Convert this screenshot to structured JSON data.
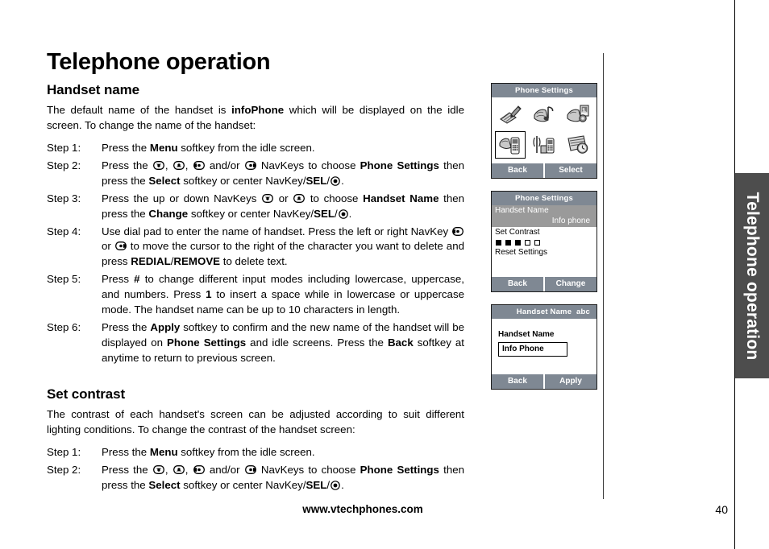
{
  "page": {
    "chapter_title": "Telephone operation",
    "side_tab_label": "Telephone operation",
    "page_number": "40",
    "footer_url": "www.vtechphones.com"
  },
  "sections": {
    "handset_name": {
      "heading": "Handset name",
      "intro_1": "The default name of the handset is ",
      "intro_bold": "infoPhone",
      "intro_2": " which will be displayed on the idle screen. To change the name of the handset:",
      "steps": [
        {
          "label": "Step 1:",
          "text": "Press the Menu softkey from the idle screen."
        },
        {
          "label": "Step 2:",
          "text": "Press the NavKeys to choose Phone Settings then press the Select softkey or center NavKey/SEL."
        },
        {
          "label": "Step 3:",
          "text": "Press the up or down NavKeys to choose Handset Name then press the Change softkey or center NavKey/SEL."
        },
        {
          "label": "Step 4:",
          "text": "Use dial pad to enter the name of handset. Press the left or right NavKey to move the cursor to the right of the character you want to delete and press REDIAL/REMOVE to delete text."
        },
        {
          "label": "Step 5:",
          "text": "Press # to change different input modes including lowercase, uppercase, and numbers. Press 1 to insert a space while in lowercase or uppercase mode. The handset name can be up to 10 characters in length."
        },
        {
          "label": "Step 6:",
          "text": "Press the Apply softkey to confirm and the new name of the handset will be displayed on Phone Settings and idle screens. Press the Back softkey at anytime to return to previous screen."
        }
      ]
    },
    "set_contrast": {
      "heading": "Set contrast",
      "intro": "The contrast of each handset's screen can be adjusted according to suit different lighting conditions. To change the contrast of the handset screen:",
      "steps": [
        {
          "label": "Step 1:",
          "text": "Press the Menu softkey from the idle screen."
        },
        {
          "label": "Step 2:",
          "text": "Press the NavKeys to choose Phone Settings then press the Select softkey or center NavKey/SEL."
        }
      ]
    }
  },
  "inline_terms": {
    "menu": "Menu",
    "select": "Select",
    "change": "Change",
    "apply": "Apply",
    "back": "Back",
    "sel": "SEL",
    "redial": "REDIAL",
    "remove": "REMOVE",
    "phone_settings": "Phone Settings",
    "handset_name": "Handset Name",
    "hash": "#",
    "one": "1",
    "infophone": "infoPhone"
  },
  "screens": [
    {
      "id": "phone-settings-grid",
      "title": "Phone Settings",
      "mode": "",
      "icons": [
        {
          "name": "notepad-pen-icon",
          "selected": false
        },
        {
          "name": "ringer-melody-icon",
          "selected": false
        },
        {
          "name": "wallpaper-photo-icon",
          "selected": false
        },
        {
          "name": "phone-settings-icon",
          "selected": true
        },
        {
          "name": "base-registration-icon",
          "selected": false
        },
        {
          "name": "clock-settings-icon",
          "selected": false
        }
      ],
      "softkeys": [
        "Back",
        "Select"
      ]
    },
    {
      "id": "phone-settings-list",
      "title": "Phone Settings",
      "mode": "",
      "items": [
        {
          "label": "Handset Name",
          "value": "Info phone",
          "highlight": true
        },
        {
          "label": "Set Contrast",
          "value": "",
          "highlight": false
        },
        {
          "label": "Reset Settings",
          "value": "",
          "highlight": false
        }
      ],
      "contrast": {
        "total": 5,
        "filled": 3
      },
      "softkeys": [
        "Back",
        "Change"
      ]
    },
    {
      "id": "handset-name-entry",
      "title": "Handset Name",
      "mode": "abc",
      "field_label": "Handset Name",
      "field_value": "Info Phone",
      "softkeys": [
        "Back",
        "Apply"
      ]
    }
  ],
  "colors": {
    "screen_chrome": "#7f8893",
    "highlight_row": "#9a9a9a",
    "side_tab": "#4d4d4d",
    "text": "#000000"
  }
}
